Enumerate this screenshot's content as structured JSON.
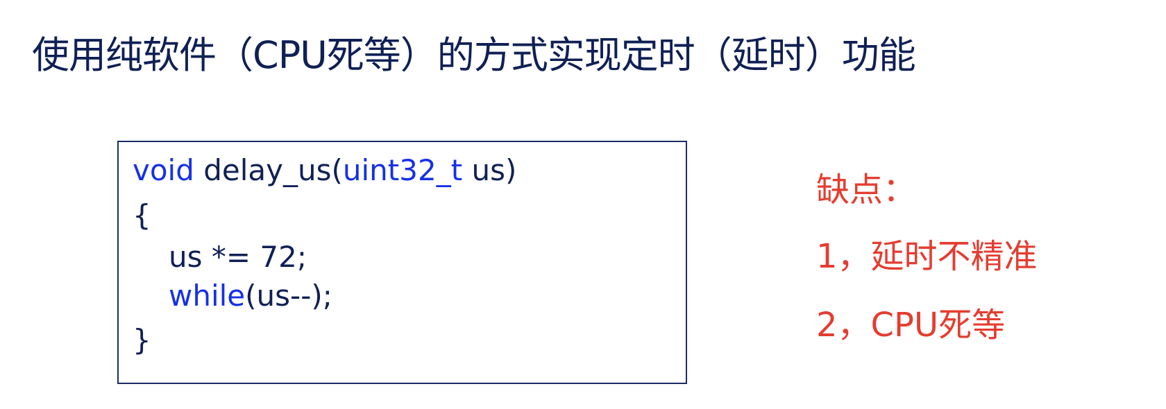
{
  "slide": {
    "title": "使用纯软件（CPU死等）的方式实现定时（延时）功能"
  },
  "code": {
    "line1": {
      "t1": "void",
      "t2": " delay_us(",
      "t3": "uint32_t",
      "t4": " us)"
    },
    "line2": "{",
    "line3": "us *= 72;",
    "line4": {
      "t1": "while",
      "t2": "(us--);"
    },
    "line5": "}"
  },
  "notes": {
    "heading": "缺点：",
    "items": [
      "1，延时不精准",
      "2，CPU死等"
    ]
  },
  "colors": {
    "title": "#0f2055",
    "keyword": "#1530e8",
    "code_text": "#0f2055",
    "notes": "#e43d30",
    "border": "#1c2a66"
  }
}
